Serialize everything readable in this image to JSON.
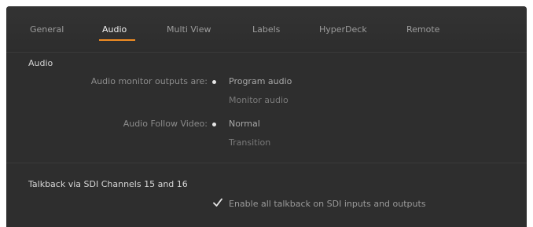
{
  "tabs": [
    {
      "label": "General",
      "active": false
    },
    {
      "label": "Audio",
      "active": true
    },
    {
      "label": "Multi View",
      "active": false
    },
    {
      "label": "Labels",
      "active": false
    },
    {
      "label": "HyperDeck",
      "active": false
    },
    {
      "label": "Remote",
      "active": false
    }
  ],
  "colors": {
    "accent": "#f08c22",
    "panel_bg": "#2e2e2e"
  },
  "audio": {
    "title": "Audio",
    "monitor_outputs": {
      "label": "Audio monitor outputs are:",
      "options": [
        {
          "label": "Program audio",
          "selected": true
        },
        {
          "label": "Monitor audio",
          "selected": false
        }
      ]
    },
    "follow_video": {
      "label": "Audio Follow Video:",
      "options": [
        {
          "label": "Normal",
          "selected": true
        },
        {
          "label": "Transition",
          "selected": false
        }
      ]
    }
  },
  "talkback": {
    "title": "Talkback via SDI Channels 15 and 16",
    "checkbox": {
      "label": "Enable all talkback on SDI inputs and outputs",
      "checked": true,
      "icon": "checkmark-icon"
    }
  }
}
